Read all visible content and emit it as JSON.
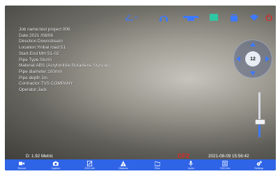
{
  "top_icons": [
    {
      "name": "angle-icon",
      "symbol": "∠"
    },
    {
      "name": "headset-icon",
      "symbol": "◠"
    },
    {
      "name": "crawler-icon",
      "symbol": "▬"
    },
    {
      "name": "camera-head-icon",
      "symbol": "■"
    },
    {
      "name": "lock-icon",
      "symbol": "▣"
    },
    {
      "name": "wifi-icon",
      "symbol": "◆"
    },
    {
      "name": "power-icon",
      "symbol": "⏻"
    }
  ],
  "osd": {
    "job_name": "Job name:test project 006",
    "date": "Date:2021 /08/06",
    "direction": "Direction:Downstream",
    "location": "Location:Yinbai road 51",
    "start_end": "Start-End MH:S1-02",
    "pipe_type": "Pipe Type:Storm",
    "material": "Material:ABS (Acrylonitrile Butadiene Styrene)",
    "pipe_diameter": "Pipe diameter:100mm",
    "pipe_depth": "Pipe depth:1m",
    "contractor": "Contractor:TVS COMPANY",
    "operator": "Operator:Jack"
  },
  "joystick_value": "12",
  "slider_level": 0.35,
  "distance": "D: 1.92 Metric",
  "counter": "CF2",
  "datetime": "2021-08-09  15:56:42",
  "bottom_buttons": [
    {
      "name": "record-button",
      "label": "Record",
      "icon": "video-camera-icon"
    },
    {
      "name": "capture-button",
      "label": "Capture",
      "icon": "camera-icon"
    },
    {
      "name": "osd-edit-button",
      "label": "OSD edit",
      "icon": "edit-icon"
    },
    {
      "name": "distance-button",
      "label": "Distance",
      "icon": "distance-icon"
    },
    {
      "name": "files-button",
      "label": "Files",
      "icon": "folder-icon"
    },
    {
      "name": "audio-button",
      "label": "Audio",
      "icon": "microphone-icon"
    },
    {
      "name": "osd-info-button",
      "label": "OSD info",
      "icon": "document-icon"
    },
    {
      "name": "settings-button",
      "label": "Settings",
      "icon": "gears-icon"
    }
  ],
  "colors": {
    "accent": "#2f64e6",
    "icon_blue": "#3d79ff",
    "counter_red": "#e02525"
  }
}
